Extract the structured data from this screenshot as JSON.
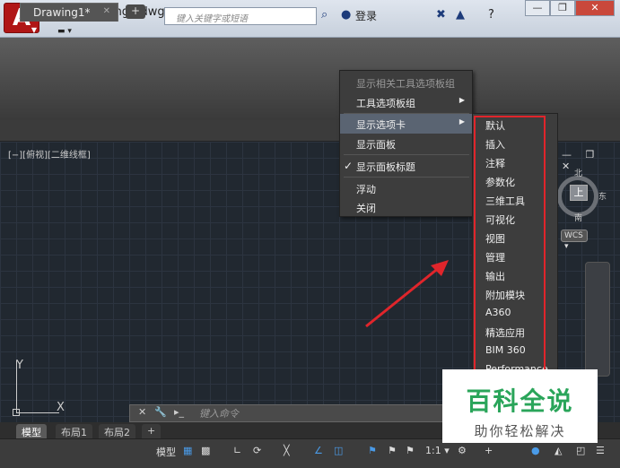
{
  "window": {
    "title": "Drawing1.dwg",
    "search_placeholder": "键入关键字或短语",
    "login_label": "登录",
    "minimize": "—",
    "restore": "❐",
    "close": "✕"
  },
  "tabs": {
    "document": "Drawing1*",
    "close_glyph": "✕",
    "add_glyph": "+"
  },
  "viewport": {
    "label": "[−][俯视][二维线框]",
    "ucs_y": "Y",
    "ucs_x": "X",
    "controls": "— ❐ ✕",
    "compass_top": "上",
    "compass_north": "北",
    "compass_south": "南",
    "compass_east": "东",
    "wcs": "WCS ▾"
  },
  "context_menu": {
    "items": [
      {
        "label": "显示相关工具选项板组",
        "disabled": true
      },
      {
        "label": "工具选项板组",
        "submenu": true
      },
      {
        "label": "显示选项卡",
        "submenu": true,
        "highlighted": true
      },
      {
        "label": "显示面板"
      },
      {
        "label": "显示面板标题",
        "checked": true
      },
      {
        "label": "浮动"
      },
      {
        "label": "关闭"
      }
    ],
    "check_glyph": "✓",
    "arrow_glyph": "▶"
  },
  "tab_submenu": {
    "items": [
      "默认",
      "插入",
      "注释",
      "参数化",
      "三维工具",
      "可视化",
      "视图",
      "管理",
      "输出",
      "附加模块",
      "A360",
      "精选应用",
      "BIM 360",
      "Performance"
    ]
  },
  "command_line": {
    "placeholder": "键入命令",
    "close_glyph": "✕",
    "wrench_glyph": "🔧",
    "prompt_glyph": "▸_"
  },
  "layout_tabs": [
    "模型",
    "布局1",
    "布局2"
  ],
  "layout_add": "+",
  "status_bar": {
    "model_label": "模型",
    "scale": "1:1 ▾",
    "grid_glyph": "▦",
    "snap_glyph": "▩",
    "menu_glyph": "☰"
  },
  "watermark": {
    "title": "百科全说",
    "subtitle": "助你轻松解决"
  },
  "colors": {
    "highlight_box": "#e0252b",
    "arrow": "#e0252b",
    "watermark_green": "#2aa55a"
  }
}
